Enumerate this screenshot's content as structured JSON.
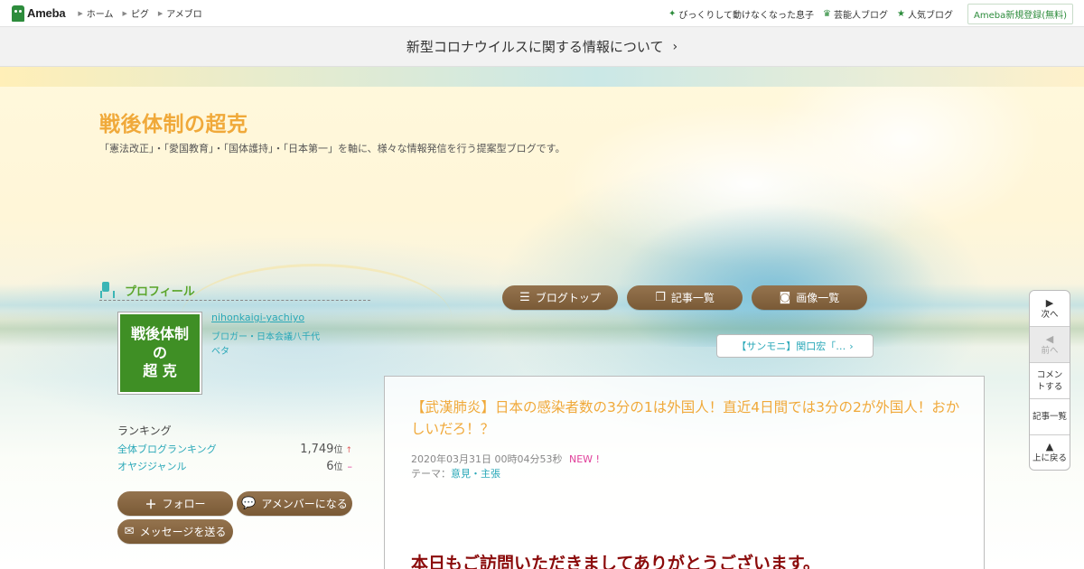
{
  "header": {
    "logo_text": "Ameba",
    "nav_left": [
      {
        "label": "ホーム"
      },
      {
        "label": "ピグ"
      },
      {
        "label": "アメブロ"
      }
    ],
    "nav_right": [
      {
        "label": "びっくりして動けなくなった息子",
        "icon": "sparkle-icon"
      },
      {
        "label": "芸能人ブログ",
        "icon": "crown-icon"
      },
      {
        "label": "人気ブログ",
        "icon": "star-icon"
      }
    ],
    "register_label": "Ameba新規登録(無料)"
  },
  "notice": {
    "text": "新型コロナウイルスに関する情報について",
    "chevron": "›"
  },
  "blog": {
    "title": "戦後体制の超克",
    "description": "「憲法改正」・「愛国教育」・「国体護持」・「日本第一」を軸に、様々な情報発信を行う提案型ブログです。"
  },
  "profile": {
    "heading": "プロフィール",
    "avatar_lines": [
      "戦後体制",
      "の",
      "超 克"
    ],
    "username": "nihonkaigi-yachiyo",
    "role": "ブロガー・日本会議八千代",
    "beta": "ベタ"
  },
  "nav_buttons": [
    {
      "label": "ブログトップ",
      "icon": "list-icon"
    },
    {
      "label": "記事一覧",
      "icon": "copy-icon"
    },
    {
      "label": "画像一覧",
      "icon": "camera-icon"
    }
  ],
  "ranking": {
    "title": "ランキング",
    "rows": [
      {
        "label": "全体ブログランキング",
        "value": "1,749",
        "unit": "位",
        "trend": "↑"
      },
      {
        "label": "オヤジジャンル",
        "value": "6",
        "unit": "位",
        "trend": "–"
      }
    ]
  },
  "profile_actions": {
    "follow": "フォロー",
    "amember": "アメンバーになる",
    "message": "メッセージを送る"
  },
  "prev_article": "【サンモニ】関口宏「…",
  "article": {
    "title": "【武漢肺炎】日本の感染者数の3分の1は外国人！直近4日間では3分の2が外国人！おかしいだろ！？",
    "datetime": "2020年03月31日 00時04分53秒",
    "new_badge": "NEW !",
    "theme_label": "テーマ：",
    "theme": "意見・主張",
    "body_first_line": "本日もご訪問いただきましてありがとうございます。"
  },
  "pager": [
    {
      "label": "次へ",
      "icon": "▶"
    },
    {
      "label": "前へ",
      "icon": "◀"
    },
    {
      "label": "コメントする"
    },
    {
      "label": "記事一覧"
    },
    {
      "label": "上に戻る",
      "icon": "▲"
    }
  ],
  "colors": {
    "accent_green": "#2d8c3c",
    "title_orange": "#f0a93a",
    "link_teal": "#2aa8b8",
    "button_brown": "#7a5a36",
    "body_red": "#8b0b0b"
  }
}
